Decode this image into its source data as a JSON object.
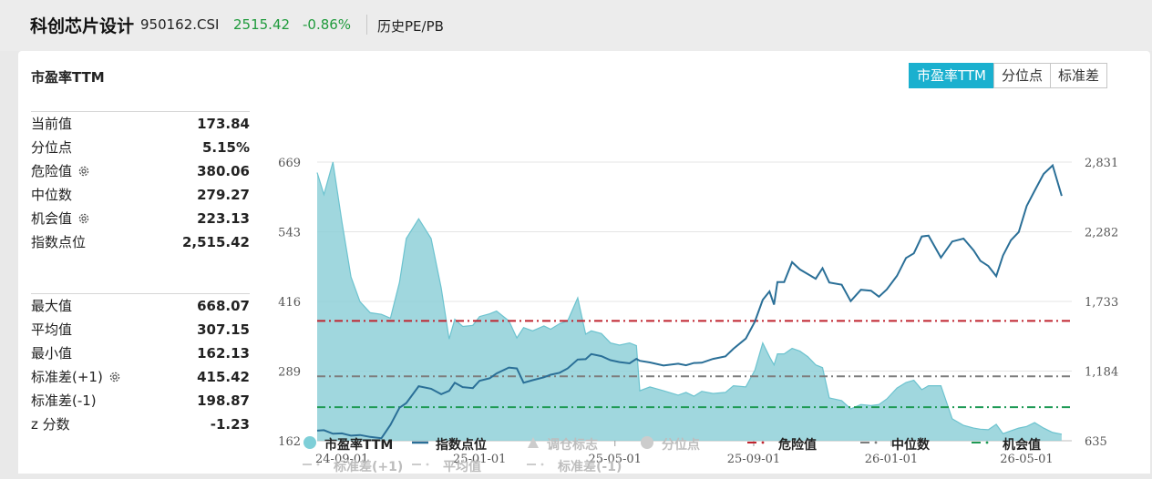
{
  "header": {
    "name": "科创芯片设计",
    "code": "950162.CSI",
    "price": "2515.42",
    "change": "-0.86%",
    "mode": "历史PE/PB"
  },
  "panel": {
    "title": "市盈率TTM",
    "tabs": [
      "市盈率TTM",
      "分位点",
      "标准差"
    ],
    "active_tab": 0
  },
  "stats_top": [
    {
      "label": "当前值",
      "value": "173.84",
      "gear": false
    },
    {
      "label": "分位点",
      "value": "5.15%",
      "gear": false
    },
    {
      "label": "危险值",
      "value": "380.06",
      "gear": true
    },
    {
      "label": "中位数",
      "value": "279.27",
      "gear": false
    },
    {
      "label": "机会值",
      "value": "223.13",
      "gear": true
    },
    {
      "label": "指数点位",
      "value": "2,515.42",
      "gear": false
    }
  ],
  "stats_bottom": [
    {
      "label": "最大值",
      "value": "668.07",
      "gear": false
    },
    {
      "label": "平均值",
      "value": "307.15",
      "gear": false
    },
    {
      "label": "最小值",
      "value": "162.13",
      "gear": false
    },
    {
      "label": "标准差(+1)",
      "value": "415.42",
      "gear": true
    },
    {
      "label": "标准差(-1)",
      "value": "198.87",
      "gear": false
    },
    {
      "label": "z 分数",
      "value": "-1.23",
      "gear": false
    }
  ],
  "legend": [
    {
      "label": "市盈率TTM",
      "symbol": "dot",
      "color": "#7ecfd8",
      "active": true
    },
    {
      "label": "指数点位",
      "symbol": "line",
      "color": "#2a6f97",
      "active": true
    },
    {
      "label": "调仓标志",
      "symbol": "triangle",
      "color": "#cccccc",
      "active": false
    },
    {
      "label": "分位点",
      "symbol": "dot",
      "color": "#cccccc",
      "active": false
    },
    {
      "label": "危险值",
      "symbol": "dashdot",
      "color": "#c0242f",
      "active": true
    },
    {
      "label": "中位数",
      "symbol": "dashdot",
      "color": "#7d7d7d",
      "active": true
    },
    {
      "label": "机会值",
      "symbol": "dashdot",
      "color": "#1f9a55",
      "active": true
    },
    {
      "label": "标准差(+1)",
      "symbol": "dashdot",
      "color": "#cccccc",
      "active": false
    },
    {
      "label": "平均值",
      "symbol": "dashdot",
      "color": "#cccccc",
      "active": false
    },
    {
      "label": "标准差(-1)",
      "symbol": "dashdot",
      "color": "#cccccc",
      "active": false
    }
  ],
  "colors": {
    "area_fill": "#8fd0d8",
    "area_line": "#6cc3cf",
    "index_line": "#2a6f97",
    "danger": "#c0242f",
    "median": "#7d7d7d",
    "chance": "#1f9a55",
    "tab_active": "#1ab0cf",
    "up_down": "#1f9a3c"
  },
  "chart_data": {
    "type": "area",
    "x_ticks": [
      "24-09-01",
      "25-01-01",
      "25-05-01",
      "25-09-01",
      "26-01-01",
      "26-05-01"
    ],
    "y_left": {
      "ticks": [
        "669",
        "543",
        "416",
        "289",
        "162"
      ],
      "range": [
        162,
        669
      ]
    },
    "y_right": {
      "ticks": [
        "2,831",
        "2,282",
        "1,733",
        "1,184",
        "635"
      ],
      "range": [
        635,
        2831
      ]
    },
    "reference_lines": [
      {
        "name": "危险值",
        "value": 380.06
      },
      {
        "name": "中位数",
        "value": 279.27
      },
      {
        "name": "机会值",
        "value": 223.13
      }
    ],
    "x_range": [
      "2024-08-10",
      "2026-06-10"
    ],
    "series": [
      {
        "name": "市盈率TTM",
        "axis": "left",
        "points": [
          [
            "2024-08-10",
            650
          ],
          [
            "2024-08-16",
            610
          ],
          [
            "2024-08-24",
            669
          ],
          [
            "2024-09-01",
            560
          ],
          [
            "2024-09-09",
            460
          ],
          [
            "2024-09-17",
            415
          ],
          [
            "2024-09-26",
            395
          ],
          [
            "2024-10-06",
            392
          ],
          [
            "2024-10-14",
            385
          ],
          [
            "2024-10-22",
            450
          ],
          [
            "2024-10-28",
            530
          ],
          [
            "2024-11-08",
            566
          ],
          [
            "2024-11-19",
            530
          ],
          [
            "2024-11-28",
            440
          ],
          [
            "2024-12-05",
            347
          ],
          [
            "2024-12-10",
            383
          ],
          [
            "2024-12-17",
            370
          ],
          [
            "2024-12-26",
            372
          ],
          [
            "2025-01-01",
            388
          ],
          [
            "2025-01-10",
            393
          ],
          [
            "2025-01-16",
            398
          ],
          [
            "2025-01-27",
            380
          ],
          [
            "2025-02-03",
            349
          ],
          [
            "2025-02-09",
            368
          ],
          [
            "2025-02-17",
            362
          ],
          [
            "2025-02-27",
            371
          ],
          [
            "2025-03-05",
            365
          ],
          [
            "2025-03-13",
            375
          ],
          [
            "2025-03-20",
            380
          ],
          [
            "2025-03-29",
            422
          ],
          [
            "2025-04-05",
            356
          ],
          [
            "2025-04-10",
            362
          ],
          [
            "2025-04-19",
            357
          ],
          [
            "2025-04-27",
            340
          ],
          [
            "2025-05-05",
            336
          ],
          [
            "2025-05-14",
            340
          ],
          [
            "2025-05-20",
            335
          ],
          [
            "2025-05-23",
            253
          ],
          [
            "2025-06-01",
            260
          ],
          [
            "2025-06-13",
            253
          ],
          [
            "2025-06-26",
            245
          ],
          [
            "2025-07-03",
            250
          ],
          [
            "2025-07-10",
            243
          ],
          [
            "2025-07-17",
            252
          ],
          [
            "2025-07-27",
            248
          ],
          [
            "2025-08-07",
            250
          ],
          [
            "2025-08-14",
            262
          ],
          [
            "2025-08-25",
            260
          ],
          [
            "2025-09-02",
            290
          ],
          [
            "2025-09-09",
            340
          ],
          [
            "2025-09-15",
            315
          ],
          [
            "2025-09-19",
            300
          ],
          [
            "2025-09-22",
            320
          ],
          [
            "2025-09-28",
            320
          ],
          [
            "2025-10-05",
            330
          ],
          [
            "2025-10-12",
            325
          ],
          [
            "2025-10-19",
            315
          ],
          [
            "2025-10-26",
            300
          ],
          [
            "2025-11-01",
            295
          ],
          [
            "2025-11-07",
            240
          ],
          [
            "2025-11-18",
            235
          ],
          [
            "2025-11-26",
            220
          ],
          [
            "2025-12-05",
            228
          ],
          [
            "2025-12-14",
            226
          ],
          [
            "2025-12-21",
            228
          ],
          [
            "2025-12-28",
            238
          ],
          [
            "2026-01-06",
            258
          ],
          [
            "2026-01-14",
            268
          ],
          [
            "2026-01-21",
            272
          ],
          [
            "2026-01-28",
            255
          ],
          [
            "2026-02-03",
            262
          ],
          [
            "2026-02-14",
            262
          ],
          [
            "2026-02-24",
            202
          ],
          [
            "2026-03-06",
            190
          ],
          [
            "2026-03-15",
            185
          ],
          [
            "2026-03-21",
            183
          ],
          [
            "2026-03-28",
            182
          ],
          [
            "2026-04-04",
            192
          ],
          [
            "2026-04-10",
            175
          ],
          [
            "2026-04-17",
            180
          ],
          [
            "2026-04-24",
            185
          ],
          [
            "2026-05-01",
            188
          ],
          [
            "2026-05-08",
            195
          ],
          [
            "2026-05-16",
            185
          ],
          [
            "2026-05-24",
            177
          ],
          [
            "2026-06-01",
            174
          ]
        ]
      },
      {
        "name": "指数点位",
        "axis": "right",
        "points": [
          [
            "2024-08-10",
            715
          ],
          [
            "2024-08-16",
            718
          ],
          [
            "2024-08-24",
            690
          ],
          [
            "2024-09-01",
            693
          ],
          [
            "2024-09-09",
            675
          ],
          [
            "2024-09-17",
            680
          ],
          [
            "2024-09-26",
            665
          ],
          [
            "2024-10-06",
            655
          ],
          [
            "2024-10-14",
            760
          ],
          [
            "2024-10-22",
            895
          ],
          [
            "2024-10-28",
            932
          ],
          [
            "2024-11-08",
            1065
          ],
          [
            "2024-11-19",
            1045
          ],
          [
            "2024-11-28",
            1002
          ],
          [
            "2024-12-05",
            1028
          ],
          [
            "2024-12-10",
            1092
          ],
          [
            "2024-12-17",
            1058
          ],
          [
            "2024-12-26",
            1050
          ],
          [
            "2025-01-01",
            1108
          ],
          [
            "2025-01-10",
            1128
          ],
          [
            "2025-01-16",
            1165
          ],
          [
            "2025-01-27",
            1212
          ],
          [
            "2025-02-03",
            1205
          ],
          [
            "2025-02-09",
            1092
          ],
          [
            "2025-02-17",
            1112
          ],
          [
            "2025-02-27",
            1135
          ],
          [
            "2025-03-05",
            1155
          ],
          [
            "2025-03-13",
            1171
          ],
          [
            "2025-03-20",
            1205
          ],
          [
            "2025-03-29",
            1275
          ],
          [
            "2025-04-05",
            1278
          ],
          [
            "2025-04-10",
            1318
          ],
          [
            "2025-04-19",
            1302
          ],
          [
            "2025-04-27",
            1270
          ],
          [
            "2025-05-05",
            1255
          ],
          [
            "2025-05-14",
            1245
          ],
          [
            "2025-05-20",
            1280
          ],
          [
            "2025-05-23",
            1265
          ],
          [
            "2025-06-01",
            1252
          ],
          [
            "2025-06-13",
            1228
          ],
          [
            "2025-06-26",
            1242
          ],
          [
            "2025-07-03",
            1230
          ],
          [
            "2025-07-10",
            1248
          ],
          [
            "2025-07-17",
            1250
          ],
          [
            "2025-07-27",
            1280
          ],
          [
            "2025-08-07",
            1300
          ],
          [
            "2025-08-14",
            1360
          ],
          [
            "2025-08-25",
            1440
          ],
          [
            "2025-09-02",
            1572
          ],
          [
            "2025-09-09",
            1745
          ],
          [
            "2025-09-15",
            1812
          ],
          [
            "2025-09-19",
            1708
          ],
          [
            "2025-09-22",
            1885
          ],
          [
            "2025-09-28",
            1885
          ],
          [
            "2025-10-05",
            2042
          ],
          [
            "2025-10-12",
            1985
          ],
          [
            "2025-10-19",
            1948
          ],
          [
            "2025-10-26",
            1912
          ],
          [
            "2025-11-01",
            1995
          ],
          [
            "2025-11-07",
            1882
          ],
          [
            "2025-11-18",
            1865
          ],
          [
            "2025-11-26",
            1735
          ],
          [
            "2025-12-05",
            1825
          ],
          [
            "2025-12-14",
            1818
          ],
          [
            "2025-12-21",
            1770
          ],
          [
            "2025-12-28",
            1828
          ],
          [
            "2026-01-06",
            1935
          ],
          [
            "2026-01-14",
            2075
          ],
          [
            "2026-01-21",
            2112
          ],
          [
            "2026-01-28",
            2245
          ],
          [
            "2026-02-03",
            2252
          ],
          [
            "2026-02-14",
            2078
          ],
          [
            "2026-02-24",
            2205
          ],
          [
            "2026-03-06",
            2228
          ],
          [
            "2026-03-15",
            2135
          ],
          [
            "2026-03-21",
            2053
          ],
          [
            "2026-03-28",
            2012
          ],
          [
            "2026-04-04",
            1932
          ],
          [
            "2026-04-10",
            2095
          ],
          [
            "2026-04-17",
            2215
          ],
          [
            "2026-04-24",
            2280
          ],
          [
            "2026-05-01",
            2485
          ],
          [
            "2026-05-08",
            2605
          ],
          [
            "2026-05-16",
            2738
          ],
          [
            "2026-05-24",
            2805
          ],
          [
            "2026-06-01",
            2565
          ]
        ]
      }
    ]
  }
}
